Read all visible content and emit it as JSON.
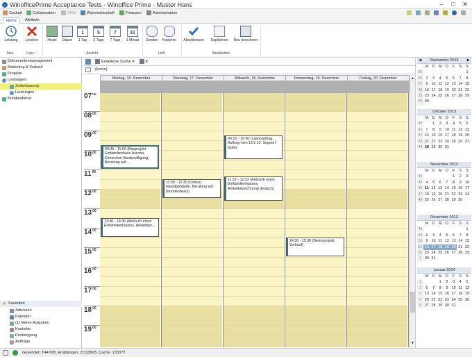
{
  "window": {
    "title": "WinofficePrime Acceptance Tests - Winoffice Prime - Muster Hans"
  },
  "modules": [
    "Cockpit",
    "Collaboration",
    "CRM",
    "Warenwirtschaft",
    "Finanzen",
    "Administration"
  ],
  "tabs": [
    "Home",
    "Attribute"
  ],
  "ribbon": {
    "buttons": [
      "Leistung",
      "Löschen",
      "Heute",
      "Datum",
      "1 Tag",
      "5 Tage",
      "7 Tage",
      "1 Monat",
      "Senden",
      "Kopieren",
      "Abschliessen",
      "Duplizieren",
      "Neu berechnen"
    ],
    "cal_numbers": [
      "1",
      "5",
      "7",
      "31"
    ],
    "groups": [
      "Neu",
      "Lösc...",
      "Ansicht",
      "Link",
      "Bearbeiten"
    ]
  },
  "nav": {
    "items": [
      "Dokumentenmanagement",
      "Marketing & Verkauf",
      "Projekte",
      "Leistungen",
      "Zeiterfassung",
      "Leistungen",
      "Kundendienst"
    ],
    "favorites_header": "Favoriten",
    "favorites": [
      "Adressen",
      "Kalender",
      "(1) Meine Aufgaben",
      "Kontakte",
      "Posteingang",
      "Aufträge"
    ]
  },
  "toolbar": {
    "search": "Erweiterte Suche",
    "filter": "(keine)"
  },
  "days": [
    "Montag, 16. Dezember",
    "Dienstag, 17. Dezember",
    "Mittwoch, 18. Dezember",
    "Donnerstag, 19. Dezember",
    "Freitag, 20. Dezember"
  ],
  "hours": [
    "07",
    "08",
    "09",
    "10",
    "11",
    "12",
    "13",
    "14",
    "15",
    "16",
    "17",
    "18",
    "19"
  ],
  "minutes": "00",
  "appointments": [
    {
      "day": 0,
      "start": 9.75,
      "end": 11,
      "text": "09:45 - 11:00 (Bauprojekt Einfamilienhaus Ascona, Einreichen Baubewilligung, Beratung auf ...",
      "sel": true
    },
    {
      "day": 0,
      "start": 13.5,
      "end": 14.5,
      "text": "13:30 - 14:30 (Abbruch eines Einfamilienhauses, Artikelbez ..."
    },
    {
      "day": 1,
      "start": 11.5,
      "end": 12.5,
      "text": "11:30 - 12:30 (Umbau Hauptgebäude, Beratung auf Stundenbasis)"
    },
    {
      "day": 2,
      "start": 9.25,
      "end": 10.5,
      "text": "09:15 - 10:30 (Laborauftrag, Auftrag vom 13.2.12, Support Gold)"
    },
    {
      "day": 2,
      "start": 11.35,
      "end": 12.65,
      "text": "11:22 - 12:22 (Abbruch eines Einfamilienhauses, Artikelbezeichnung deutsch)"
    },
    {
      "day": 3,
      "start": 14.5,
      "end": 15.5,
      "text": "14:30 - 15:30 (Demoprojekt, Verkauf)"
    }
  ],
  "weekday_heads": [
    "M",
    "D",
    "M",
    "D",
    "F",
    "S",
    "S"
  ],
  "months": [
    {
      "name": "September 2013",
      "weeks": [
        [
          "35",
          "",
          "",
          "",
          "",
          "",
          "",
          "1"
        ],
        [
          "36",
          "2",
          "3",
          "4",
          "5",
          "6",
          "7",
          "8"
        ],
        [
          "37",
          "9",
          "10",
          "11",
          "12",
          "13",
          "14",
          "15"
        ],
        [
          "38",
          "16",
          "17",
          "18",
          "19",
          "20",
          "21",
          "22"
        ],
        [
          "39",
          "23",
          "24",
          "25",
          "26",
          "27",
          "28",
          "29"
        ],
        [
          "40",
          "30",
          "",
          "",
          "",
          "",
          "",
          ""
        ]
      ]
    },
    {
      "name": "Oktober 2013",
      "weeks": [
        [
          "40",
          "",
          "1",
          "2",
          "3",
          "4",
          "5",
          "6"
        ],
        [
          "41",
          "7",
          "8",
          "9",
          "10",
          "11",
          "12",
          "13"
        ],
        [
          "42",
          "14",
          "15",
          "16",
          "17",
          "18",
          "19",
          "20"
        ],
        [
          "43",
          "21",
          "22",
          "23",
          "24",
          "25",
          "26",
          "27"
        ],
        [
          "44",
          "28",
          "29",
          "30",
          "31",
          "",
          "",
          ""
        ]
      ]
    },
    {
      "name": "November 2013",
      "weeks": [
        [
          "44",
          "",
          "",
          "",
          "",
          "1",
          "2",
          "3"
        ],
        [
          "45",
          "4",
          "5",
          "6",
          "7",
          "8",
          "9",
          "10"
        ],
        [
          "46",
          "11",
          "12",
          "13",
          "14",
          "15",
          "16",
          "17"
        ],
        [
          "47",
          "18",
          "19",
          "20",
          "21",
          "22",
          "23",
          "24"
        ],
        [
          "48",
          "25",
          "26",
          "27",
          "28",
          "29",
          "30",
          ""
        ]
      ]
    },
    {
      "name": "Dezember 2013",
      "weeks": [
        [
          "48",
          "",
          "",
          "",
          "",
          "",
          "",
          "1"
        ],
        [
          "49",
          "2",
          "3",
          "4",
          "5",
          "6",
          "7",
          "8"
        ],
        [
          "50",
          "9",
          "10",
          "11",
          "12",
          "13",
          "14",
          "15"
        ],
        [
          "51",
          "16",
          "17",
          "18",
          "19",
          "20",
          "21",
          "22"
        ],
        [
          "52",
          "23",
          "24",
          "25",
          "26",
          "27",
          "28",
          "29"
        ],
        [
          "1",
          "30",
          "31",
          "",
          "",
          "",
          "",
          ""
        ]
      ]
    },
    {
      "name": "Januar 2014",
      "weeks": [
        [
          "1",
          "",
          "",
          "1",
          "2",
          "3",
          "4",
          "5"
        ],
        [
          "2",
          "6",
          "7",
          "8",
          "9",
          "10",
          "11",
          "12"
        ],
        [
          "3",
          "13",
          "14",
          "15",
          "16",
          "17",
          "18",
          "19"
        ],
        [
          "4",
          "20",
          "21",
          "22",
          "23",
          "24",
          "25",
          "26"
        ],
        [
          "5",
          "27",
          "28",
          "29",
          "30",
          "31",
          "",
          ""
        ]
      ]
    }
  ],
  "status": "Gesendet: 3'447KB, Empfangen: 21'028KB, Cache: 133072"
}
